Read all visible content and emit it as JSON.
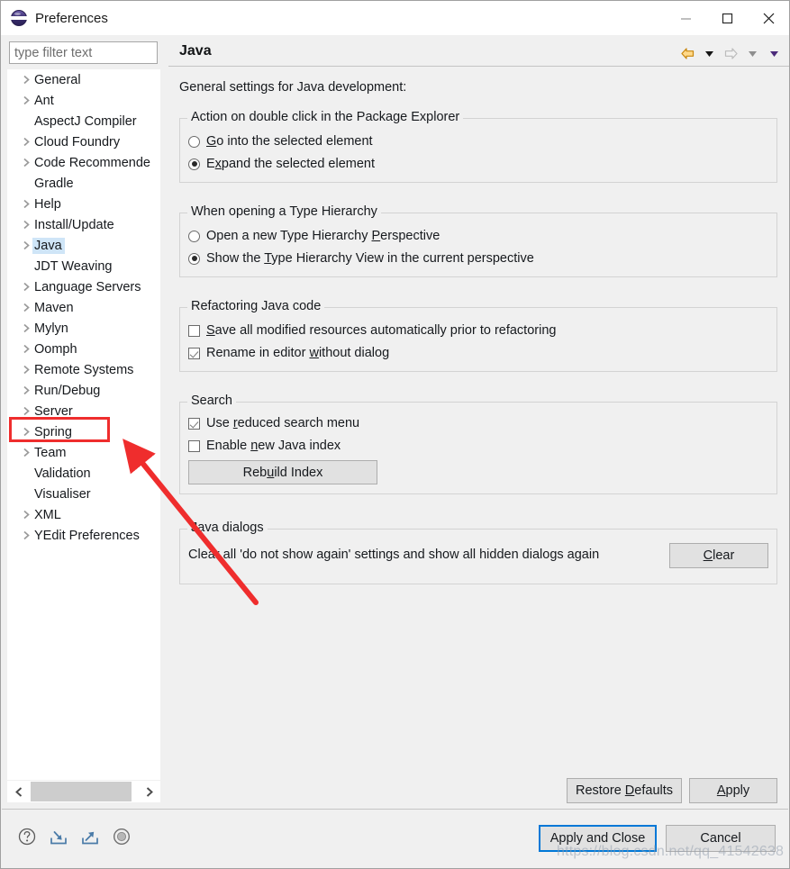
{
  "window": {
    "title": "Preferences",
    "icon": "eclipse-icon",
    "controls": {
      "minimize": "minimize-icon",
      "maximize": "maximize-icon",
      "close": "close-icon"
    }
  },
  "sidebar": {
    "filter": {
      "value": "",
      "placeholder": "type filter text"
    },
    "items": [
      {
        "label": "General",
        "expandable": true,
        "selected": false
      },
      {
        "label": "Ant",
        "expandable": true,
        "selected": false
      },
      {
        "label": "AspectJ Compiler",
        "expandable": false,
        "selected": false
      },
      {
        "label": "Cloud Foundry",
        "expandable": true,
        "selected": false
      },
      {
        "label": "Code Recommende",
        "expandable": true,
        "selected": false
      },
      {
        "label": "Gradle",
        "expandable": false,
        "selected": false
      },
      {
        "label": "Help",
        "expandable": true,
        "selected": false
      },
      {
        "label": "Install/Update",
        "expandable": true,
        "selected": false
      },
      {
        "label": "Java",
        "expandable": true,
        "selected": true
      },
      {
        "label": "JDT Weaving",
        "expandable": false,
        "selected": false
      },
      {
        "label": "Language Servers",
        "expandable": true,
        "selected": false
      },
      {
        "label": "Maven",
        "expandable": true,
        "selected": false
      },
      {
        "label": "Mylyn",
        "expandable": true,
        "selected": false
      },
      {
        "label": "Oomph",
        "expandable": true,
        "selected": false
      },
      {
        "label": "Remote Systems",
        "expandable": true,
        "selected": false
      },
      {
        "label": "Run/Debug",
        "expandable": true,
        "selected": false
      },
      {
        "label": "Server",
        "expandable": true,
        "selected": false
      },
      {
        "label": "Spring",
        "expandable": true,
        "selected": false
      },
      {
        "label": "Team",
        "expandable": true,
        "selected": false
      },
      {
        "label": "Validation",
        "expandable": false,
        "selected": false
      },
      {
        "label": "Visualiser",
        "expandable": false,
        "selected": false
      },
      {
        "label": "XML",
        "expandable": true,
        "selected": false
      },
      {
        "label": "YEdit Preferences",
        "expandable": true,
        "selected": false
      }
    ],
    "scrollbar": {
      "left_arrow": "chevron-left-icon",
      "right_arrow": "chevron-right-icon"
    }
  },
  "page": {
    "title": "Java",
    "intro": "General settings for Java development:",
    "nav": {
      "back": "back-arrow-icon",
      "back_menu": "chevron-down-icon",
      "forward": "forward-arrow-icon",
      "forward_menu": "chevron-down-icon",
      "view_menu": "chevron-down-icon"
    },
    "groups": [
      {
        "title": "Action on double click in the Package Explorer",
        "options": [
          {
            "label_pre": "",
            "mnemonic": "G",
            "label_post": "o into the selected element",
            "checked": false
          },
          {
            "label_pre": "E",
            "mnemonic": "x",
            "label_post": "pand the selected element",
            "checked": true
          }
        ]
      },
      {
        "title": "When opening a Type Hierarchy",
        "options": [
          {
            "label_pre": "Open a new Type Hierarchy ",
            "mnemonic": "P",
            "label_post": "erspective",
            "checked": false
          },
          {
            "label_pre": "Show the ",
            "mnemonic": "T",
            "label_post": "ype Hierarchy View in the current perspective",
            "checked": true
          }
        ]
      },
      {
        "title": "Refactoring Java code",
        "options": [
          {
            "label_pre": "",
            "mnemonic": "S",
            "label_post": "ave all modified resources automatically prior to refactoring",
            "checked": false
          },
          {
            "label_pre": "Rename in editor ",
            "mnemonic": "w",
            "label_post": "ithout dialog",
            "checked": true
          }
        ]
      },
      {
        "title": "Search",
        "options": [
          {
            "label_pre": "Use ",
            "mnemonic": "r",
            "label_post": "educed search menu",
            "checked": true
          },
          {
            "label_pre": "Enable ",
            "mnemonic": "n",
            "label_post": "ew Java index",
            "checked": false
          }
        ],
        "button": {
          "label_pre": "Reb",
          "mnemonic": "u",
          "label_post": "ild Index"
        }
      },
      {
        "title": "Java dialogs",
        "description": "Clear all 'do not show again' settings and show all hidden dialogs again",
        "button": {
          "label_pre": "",
          "mnemonic": "C",
          "label_post": "lear"
        }
      }
    ],
    "page_buttons": {
      "restore_defaults": {
        "label_pre": "Restore ",
        "mnemonic": "D",
        "label_post": "efaults"
      },
      "apply": {
        "label_pre": "",
        "mnemonic": "A",
        "label_post": "pply"
      }
    }
  },
  "footer": {
    "icons": [
      {
        "name": "help-icon"
      },
      {
        "name": "import-icon"
      },
      {
        "name": "export-icon"
      },
      {
        "name": "record-icon"
      }
    ],
    "apply_and_close": "Apply and Close",
    "cancel": "Cancel"
  },
  "annotations": {
    "highlight_target": "Spring",
    "arrow_color": "#ef2d2d",
    "watermark": "https://blog.csdn.net/qq_41542638"
  }
}
